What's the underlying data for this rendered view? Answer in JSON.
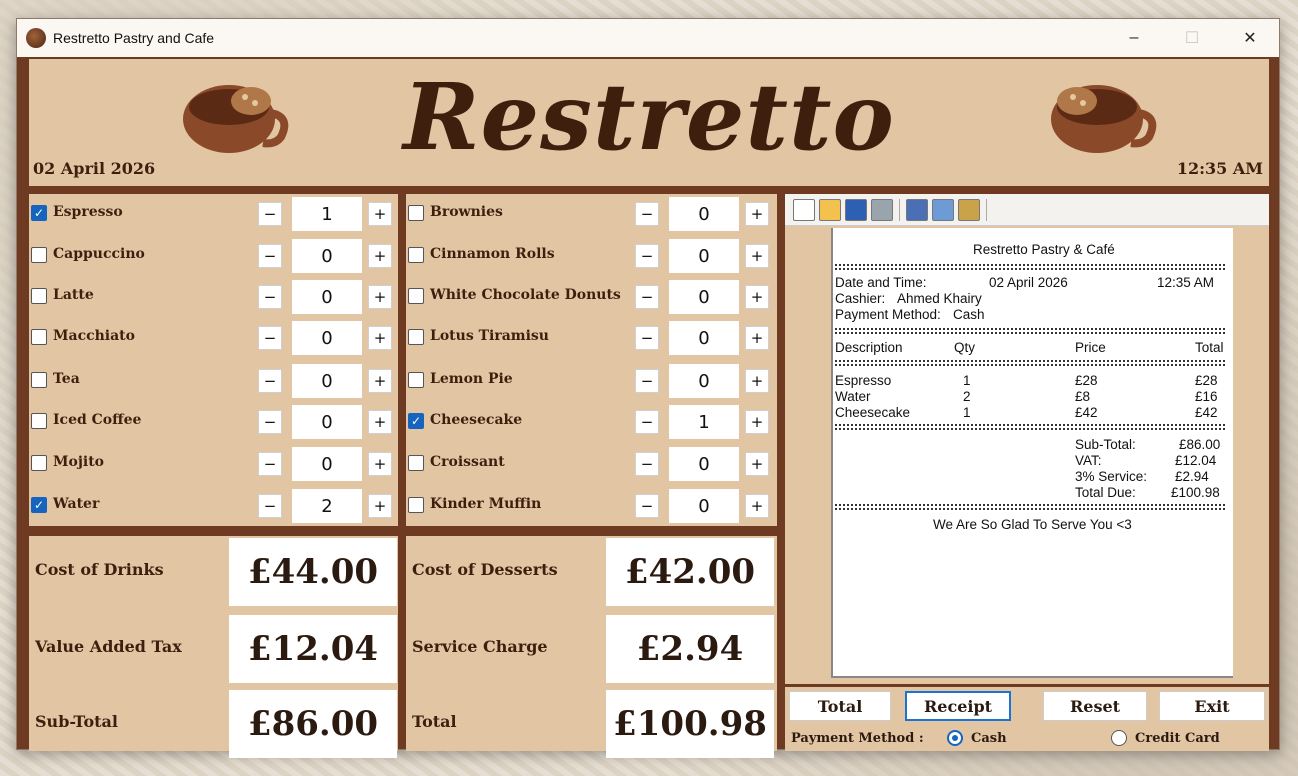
{
  "window": {
    "title": "Restretto Pastry and Cafe",
    "minimize": "–",
    "maximize": "☐",
    "close": "✕"
  },
  "header": {
    "brand": "Restretto",
    "date": "02 April 2026",
    "time": "12:35 AM"
  },
  "drinks": [
    {
      "label": "Espresso",
      "checked": true,
      "qty": "1"
    },
    {
      "label": "Cappuccino",
      "checked": false,
      "qty": "0"
    },
    {
      "label": "Latte",
      "checked": false,
      "qty": "0"
    },
    {
      "label": "Macchiato",
      "checked": false,
      "qty": "0"
    },
    {
      "label": "Tea",
      "checked": false,
      "qty": "0"
    },
    {
      "label": "Iced Coffee",
      "checked": false,
      "qty": "0"
    },
    {
      "label": "Mojito",
      "checked": false,
      "qty": "0"
    },
    {
      "label": "Water",
      "checked": true,
      "qty": "2"
    }
  ],
  "desserts": [
    {
      "label": "Brownies",
      "checked": false,
      "qty": "0"
    },
    {
      "label": "Cinnamon Rolls",
      "checked": false,
      "qty": "0"
    },
    {
      "label": "White Chocolate Donuts",
      "checked": false,
      "qty": "0"
    },
    {
      "label": "Lotus Tiramisu",
      "checked": false,
      "qty": "0"
    },
    {
      "label": "Lemon Pie",
      "checked": false,
      "qty": "0"
    },
    {
      "label": "Cheesecake",
      "checked": true,
      "qty": "1"
    },
    {
      "label": "Croissant",
      "checked": false,
      "qty": "0"
    },
    {
      "label": "Kinder Muffin",
      "checked": false,
      "qty": "0"
    }
  ],
  "stepper": {
    "minus": "−",
    "plus": "+"
  },
  "totals_left": [
    {
      "label": "Cost of Drinks",
      "value": "£44.00"
    },
    {
      "label": "Value Added Tax",
      "value": "£12.04"
    },
    {
      "label": "Sub-Total",
      "value": "£86.00"
    }
  ],
  "totals_right": [
    {
      "label": "Cost of Desserts",
      "value": "£42.00"
    },
    {
      "label": "Service Charge",
      "value": "£2.94"
    },
    {
      "label": "Total",
      "value": "£100.98"
    }
  ],
  "toolbar": {
    "icons": [
      "new-icon",
      "open-icon",
      "save-icon",
      "print-icon",
      "cut-icon",
      "copy-icon",
      "paste-icon"
    ]
  },
  "receipt": {
    "title": "Restretto Pastry & Café",
    "date_label": "Date and Time:",
    "date_value": "02 April 2026",
    "time_value": "12:35 AM",
    "cashier_label": "Cashier:",
    "cashier_value": "Ahmed Khairy",
    "method_label": "Payment Method:",
    "method_value": "Cash",
    "col_desc": "Description",
    "col_qty": "Qty",
    "col_price": "Price",
    "col_total": "Total",
    "items": [
      {
        "desc": "Espresso",
        "qty": "1",
        "price": "£28",
        "total": "£28"
      },
      {
        "desc": "Water",
        "qty": "2",
        "price": "£8",
        "total": "£16"
      },
      {
        "desc": "Cheesecake",
        "qty": "1",
        "price": "£42",
        "total": "£42"
      }
    ],
    "subtotal_label": "Sub-Total:",
    "subtotal_value": "£86.00",
    "vat_label": "VAT:",
    "vat_value": "£12.04",
    "service_label": "3% Service:",
    "service_value": "£2.94",
    "due_label": "Total Due:",
    "due_value": "£100.98",
    "footer": "We Are So Glad To Serve You <3"
  },
  "actions": {
    "total": "Total",
    "receipt": "Receipt",
    "reset": "Reset",
    "exit": "Exit"
  },
  "payment": {
    "label": "Payment Method :",
    "cash": "Cash",
    "card": "Credit Card",
    "selected": "Cash"
  },
  "colors": {
    "frame": "#6e3a22",
    "panel": "#e2c5a3",
    "text": "#3e1f0e",
    "accent": "#1565c0"
  }
}
